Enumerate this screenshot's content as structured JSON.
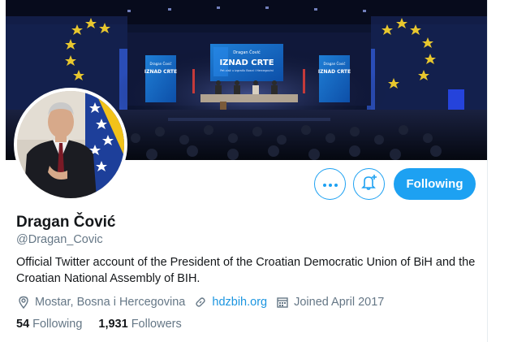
{
  "banner": {
    "stage_screen_title": "IZNAD CRTE",
    "stage_screen_top": "Dragan Čović",
    "stage_screen_sub": "Pet zlaž u izgrađu Bosni i Hercegovini",
    "side_screen_title": "IZNAD CRTE",
    "side_screen_top": "Dragan Čović"
  },
  "actions": {
    "more_icon": "more-icon",
    "notify_icon": "bell-plus-icon",
    "following_label": "Following"
  },
  "profile": {
    "name": "Dragan Čović",
    "handle": "@Dragan_Covic",
    "bio": "Official Twitter account of the President of the Croatian Democratic Union of BiH and the Croatian National Assembly of BIH.",
    "location": "Mostar, Bosna i Hercegovina",
    "website": "hdzbih.org",
    "joined": "Joined April 2017"
  },
  "stats": {
    "following_count": "54",
    "following_label": "Following",
    "followers_count": "1,931",
    "followers_label": "Followers"
  },
  "colors": {
    "accent": "#1da1f2",
    "link": "#1b95e0",
    "muted": "#657786",
    "text": "#14171a"
  }
}
